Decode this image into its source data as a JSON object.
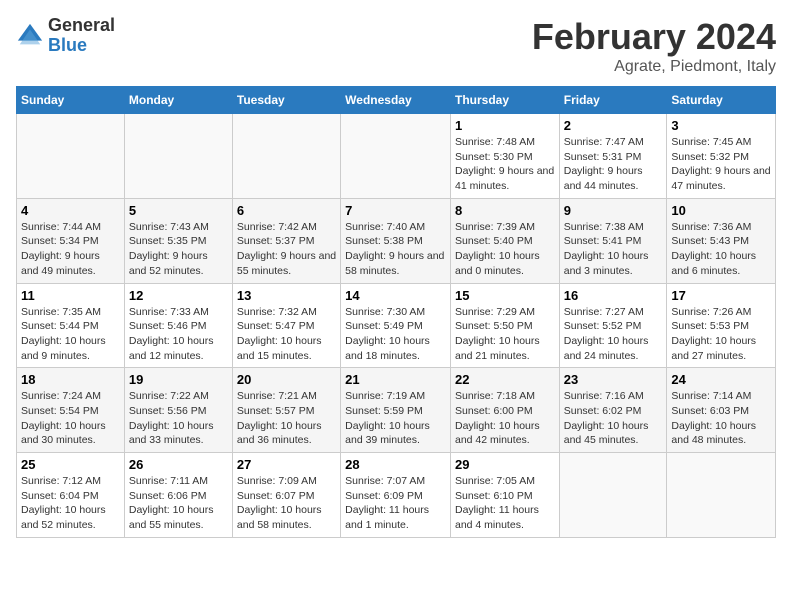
{
  "logo": {
    "general": "General",
    "blue": "Blue"
  },
  "title": "February 2024",
  "subtitle": "Agrate, Piedmont, Italy",
  "days_of_week": [
    "Sunday",
    "Monday",
    "Tuesday",
    "Wednesday",
    "Thursday",
    "Friday",
    "Saturday"
  ],
  "weeks": [
    [
      {
        "day": "",
        "info": ""
      },
      {
        "day": "",
        "info": ""
      },
      {
        "day": "",
        "info": ""
      },
      {
        "day": "",
        "info": ""
      },
      {
        "day": "1",
        "info": "Sunrise: 7:48 AM\nSunset: 5:30 PM\nDaylight: 9 hours\nand 41 minutes."
      },
      {
        "day": "2",
        "info": "Sunrise: 7:47 AM\nSunset: 5:31 PM\nDaylight: 9 hours\nand 44 minutes."
      },
      {
        "day": "3",
        "info": "Sunrise: 7:45 AM\nSunset: 5:32 PM\nDaylight: 9 hours\nand 47 minutes."
      }
    ],
    [
      {
        "day": "4",
        "info": "Sunrise: 7:44 AM\nSunset: 5:34 PM\nDaylight: 9 hours\nand 49 minutes."
      },
      {
        "day": "5",
        "info": "Sunrise: 7:43 AM\nSunset: 5:35 PM\nDaylight: 9 hours\nand 52 minutes."
      },
      {
        "day": "6",
        "info": "Sunrise: 7:42 AM\nSunset: 5:37 PM\nDaylight: 9 hours\nand 55 minutes."
      },
      {
        "day": "7",
        "info": "Sunrise: 7:40 AM\nSunset: 5:38 PM\nDaylight: 9 hours\nand 58 minutes."
      },
      {
        "day": "8",
        "info": "Sunrise: 7:39 AM\nSunset: 5:40 PM\nDaylight: 10 hours\nand 0 minutes."
      },
      {
        "day": "9",
        "info": "Sunrise: 7:38 AM\nSunset: 5:41 PM\nDaylight: 10 hours\nand 3 minutes."
      },
      {
        "day": "10",
        "info": "Sunrise: 7:36 AM\nSunset: 5:43 PM\nDaylight: 10 hours\nand 6 minutes."
      }
    ],
    [
      {
        "day": "11",
        "info": "Sunrise: 7:35 AM\nSunset: 5:44 PM\nDaylight: 10 hours\nand 9 minutes."
      },
      {
        "day": "12",
        "info": "Sunrise: 7:33 AM\nSunset: 5:46 PM\nDaylight: 10 hours\nand 12 minutes."
      },
      {
        "day": "13",
        "info": "Sunrise: 7:32 AM\nSunset: 5:47 PM\nDaylight: 10 hours\nand 15 minutes."
      },
      {
        "day": "14",
        "info": "Sunrise: 7:30 AM\nSunset: 5:49 PM\nDaylight: 10 hours\nand 18 minutes."
      },
      {
        "day": "15",
        "info": "Sunrise: 7:29 AM\nSunset: 5:50 PM\nDaylight: 10 hours\nand 21 minutes."
      },
      {
        "day": "16",
        "info": "Sunrise: 7:27 AM\nSunset: 5:52 PM\nDaylight: 10 hours\nand 24 minutes."
      },
      {
        "day": "17",
        "info": "Sunrise: 7:26 AM\nSunset: 5:53 PM\nDaylight: 10 hours\nand 27 minutes."
      }
    ],
    [
      {
        "day": "18",
        "info": "Sunrise: 7:24 AM\nSunset: 5:54 PM\nDaylight: 10 hours\nand 30 minutes."
      },
      {
        "day": "19",
        "info": "Sunrise: 7:22 AM\nSunset: 5:56 PM\nDaylight: 10 hours\nand 33 minutes."
      },
      {
        "day": "20",
        "info": "Sunrise: 7:21 AM\nSunset: 5:57 PM\nDaylight: 10 hours\nand 36 minutes."
      },
      {
        "day": "21",
        "info": "Sunrise: 7:19 AM\nSunset: 5:59 PM\nDaylight: 10 hours\nand 39 minutes."
      },
      {
        "day": "22",
        "info": "Sunrise: 7:18 AM\nSunset: 6:00 PM\nDaylight: 10 hours\nand 42 minutes."
      },
      {
        "day": "23",
        "info": "Sunrise: 7:16 AM\nSunset: 6:02 PM\nDaylight: 10 hours\nand 45 minutes."
      },
      {
        "day": "24",
        "info": "Sunrise: 7:14 AM\nSunset: 6:03 PM\nDaylight: 10 hours\nand 48 minutes."
      }
    ],
    [
      {
        "day": "25",
        "info": "Sunrise: 7:12 AM\nSunset: 6:04 PM\nDaylight: 10 hours\nand 52 minutes."
      },
      {
        "day": "26",
        "info": "Sunrise: 7:11 AM\nSunset: 6:06 PM\nDaylight: 10 hours\nand 55 minutes."
      },
      {
        "day": "27",
        "info": "Sunrise: 7:09 AM\nSunset: 6:07 PM\nDaylight: 10 hours\nand 58 minutes."
      },
      {
        "day": "28",
        "info": "Sunrise: 7:07 AM\nSunset: 6:09 PM\nDaylight: 11 hours\nand 1 minute."
      },
      {
        "day": "29",
        "info": "Sunrise: 7:05 AM\nSunset: 6:10 PM\nDaylight: 11 hours\nand 4 minutes."
      },
      {
        "day": "",
        "info": ""
      },
      {
        "day": "",
        "info": ""
      }
    ]
  ]
}
